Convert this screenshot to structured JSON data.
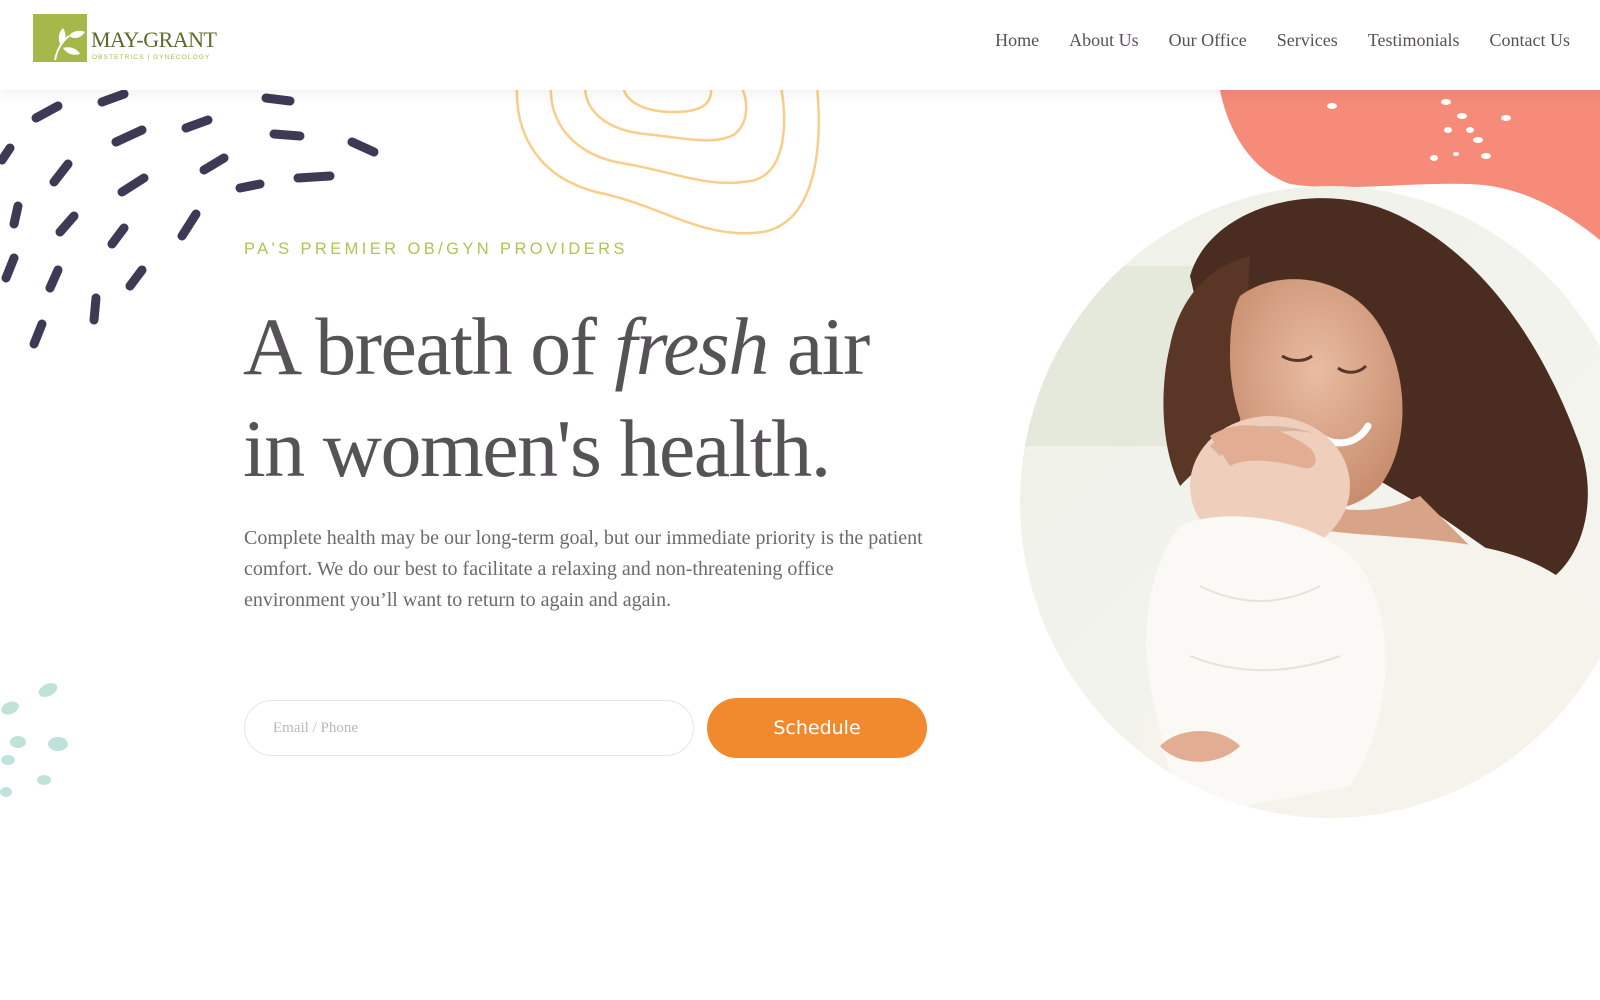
{
  "brand": {
    "name": "MAY-GRANT",
    "tagline": "OBSTETRICS | GYNECOLOGY",
    "logo_color": "#a6b84a"
  },
  "nav": {
    "items": [
      {
        "label": "Home"
      },
      {
        "label": "About Us"
      },
      {
        "label": "Our Office"
      },
      {
        "label": "Services"
      },
      {
        "label": "Testimonials"
      },
      {
        "label": "Contact Us"
      }
    ]
  },
  "hero": {
    "eyebrow": "PA'S PREMIER OB/GYN PROVIDERS",
    "headline_part1": "A breath of ",
    "headline_emphasis": "fresh",
    "headline_part2": " air",
    "headline_line2": "in women's health.",
    "body": "Complete health may be our long-term goal, but our immediate priority is the patient comfort. We do our best to facilitate a relaxing and non-threatening office environment you’ll want to return to again and again."
  },
  "form": {
    "input_placeholder": "Email / Phone",
    "input_value": "",
    "submit_label": "Schedule"
  },
  "icons": {
    "logo": "leaf-icon"
  },
  "colors": {
    "accent_green": "#a6b84a",
    "button_orange": "#f18a2e",
    "coral": "#f58b78",
    "ring_yellow": "#f9ce8a",
    "dash_navy": "#3c3a55",
    "dash_teal": "#bfe3d8",
    "headline_text": "#565356"
  }
}
